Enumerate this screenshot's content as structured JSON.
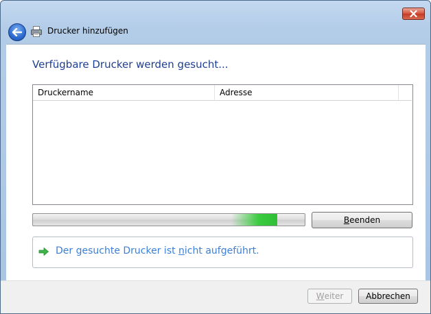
{
  "window": {
    "title": "Drucker hinzufügen"
  },
  "heading": "Verfügbare Drucker werden gesucht...",
  "list": {
    "columns": [
      "Druckername",
      "Adresse"
    ],
    "rows": []
  },
  "progress": {
    "state": "searching",
    "fraction": 0.9
  },
  "buttons": {
    "stop": {
      "label_pre": "",
      "label_u": "B",
      "label_post": "eenden"
    },
    "next": {
      "label_pre": "",
      "label_u": "W",
      "label_post": "eiter",
      "enabled": false
    },
    "cancel": {
      "label": "Abbrechen"
    }
  },
  "option": {
    "pre": "Der gesuchte Drucker ist ",
    "u": "n",
    "post": "icht aufgeführt."
  },
  "icons": {
    "back": "back-arrow-icon",
    "printer": "printer-icon",
    "close": "close-icon",
    "option": "green-arrow-icon"
  },
  "colors": {
    "heading": "#1e3e91",
    "link": "#3b7fd6",
    "progress": "#3acb40"
  }
}
